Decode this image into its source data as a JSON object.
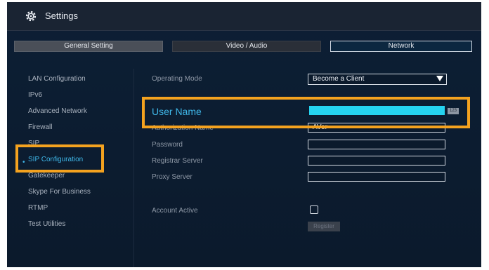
{
  "app": {
    "title": "Settings",
    "icon": "gear-icon"
  },
  "tabs": [
    {
      "label": "General Setting"
    },
    {
      "label": "Video / Audio"
    },
    {
      "label": "Network"
    }
  ],
  "sidebar": {
    "items": [
      {
        "label": "LAN Configuration"
      },
      {
        "label": "IPv6"
      },
      {
        "label": "Advanced Network"
      },
      {
        "label": "Firewall"
      },
      {
        "label": "SIP"
      },
      {
        "label": "SIP Configuration"
      },
      {
        "label": "Gatekeeper"
      },
      {
        "label": "Skype For Business"
      },
      {
        "label": "RTMP"
      },
      {
        "label": "Test Utilities"
      }
    ],
    "active_bullet": "•"
  },
  "form": {
    "operating_mode": {
      "label": "Operating Mode",
      "value": "Become a Client"
    },
    "user_name": {
      "label": "User Name",
      "value": ""
    },
    "keyboard_badge": "123",
    "authorization_name": {
      "label": "Authorization Name",
      "value": "AVer"
    },
    "password": {
      "label": "Password",
      "value": ""
    },
    "registrar_server": {
      "label": "Registrar Server",
      "value": ""
    },
    "proxy_server": {
      "label": "Proxy Server",
      "value": ""
    },
    "account_active": {
      "label": "Account Active",
      "checked": false
    },
    "register_button": "Register"
  },
  "colors": {
    "accent": "#3fb7e8",
    "highlight": "#f4a21f",
    "input_active": "#25d3f0",
    "background": "#0c1b2e"
  }
}
